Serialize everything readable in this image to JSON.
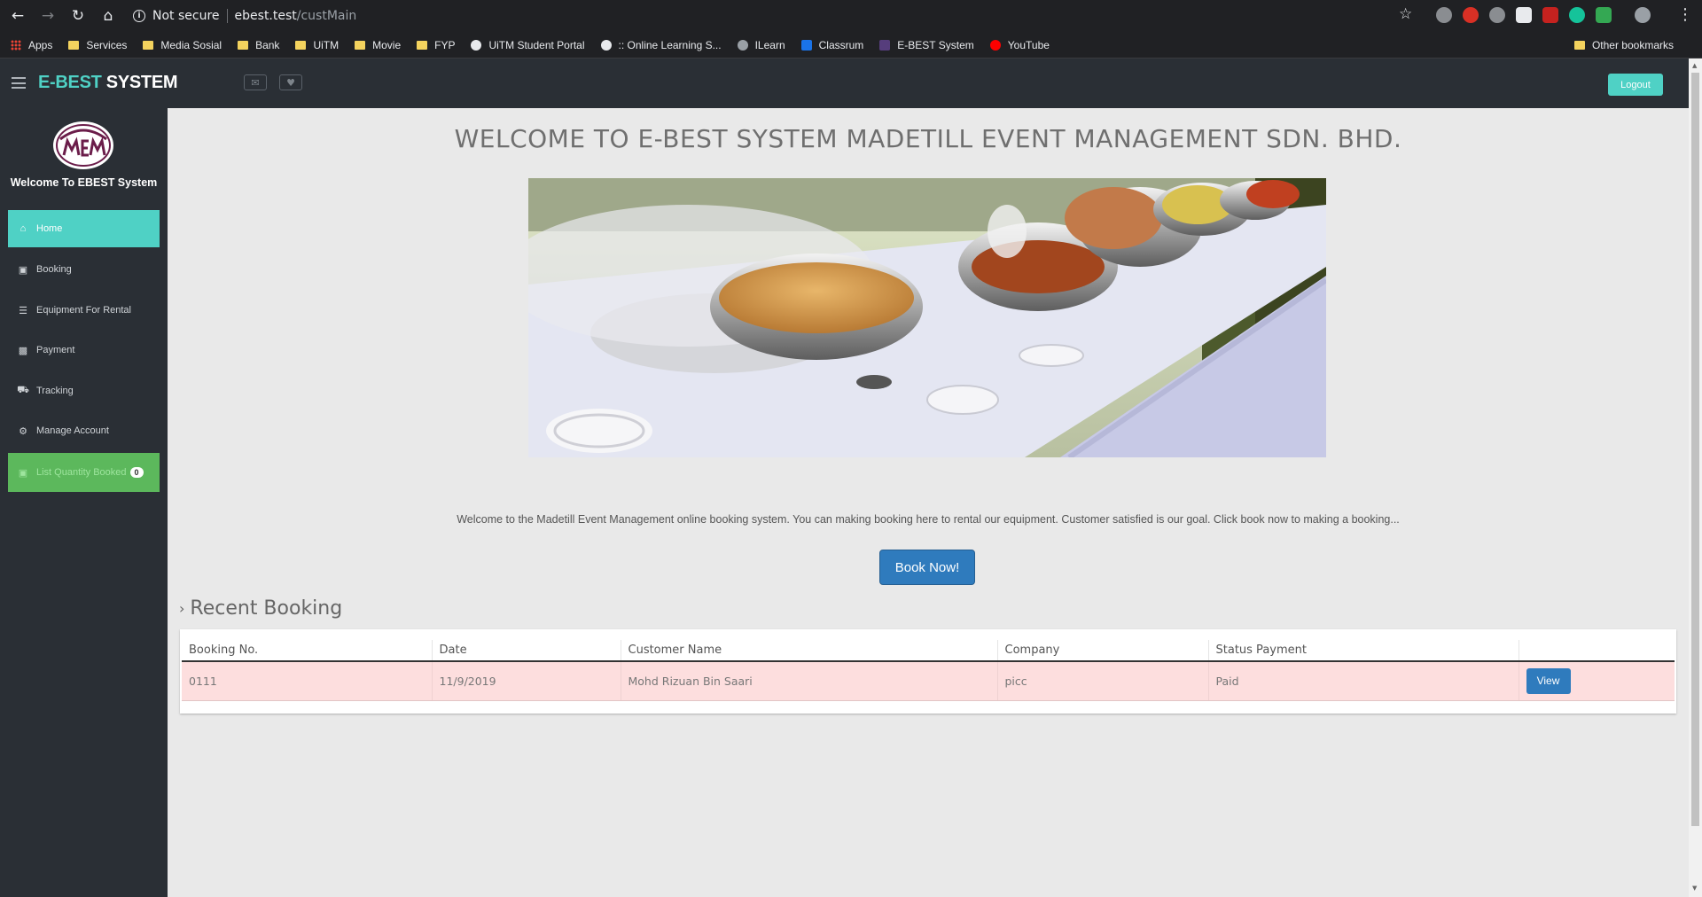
{
  "browser": {
    "security_label": "Not secure",
    "url_host": "ebest.test",
    "url_path": "/custMain",
    "bookmarks": [
      {
        "label": "Apps",
        "icon": "apps-grid-icon"
      },
      {
        "label": "Services",
        "icon": "folder-icon"
      },
      {
        "label": "Media Sosial",
        "icon": "folder-icon"
      },
      {
        "label": "Bank",
        "icon": "folder-icon"
      },
      {
        "label": "UiTM",
        "icon": "folder-icon"
      },
      {
        "label": "Movie",
        "icon": "folder-icon"
      },
      {
        "label": "FYP",
        "icon": "folder-icon"
      },
      {
        "label": "UiTM Student Portal",
        "icon": "globe-icon"
      },
      {
        "label": ":: Online Learning S...",
        "icon": "globe-icon"
      },
      {
        "label": "ILearn",
        "icon": "site-icon"
      },
      {
        "label": "Classrum",
        "icon": "classroom-icon"
      },
      {
        "label": "E-BEST System",
        "icon": "bootstrap-icon"
      },
      {
        "label": "YouTube",
        "icon": "youtube-icon"
      }
    ],
    "other_bookmarks": "Other bookmarks"
  },
  "header": {
    "brand_accent": "E-BEST",
    "brand_rest": " SYSTEM",
    "logout_label": "Logout"
  },
  "sidebar": {
    "welcome": "Welcome To EBEST System",
    "items": [
      {
        "label": "Home",
        "icon": "home-icon",
        "active": true
      },
      {
        "label": "Booking",
        "icon": "cart-icon"
      },
      {
        "label": "Equipment For Rental",
        "icon": "list-icon"
      },
      {
        "label": "Payment",
        "icon": "money-icon"
      },
      {
        "label": "Tracking",
        "icon": "truck-icon"
      },
      {
        "label": "Manage Account",
        "icon": "gears-icon"
      }
    ],
    "cart": {
      "label": "List Quantity Booked",
      "count": "0"
    }
  },
  "main": {
    "title": "WELCOME TO E-BEST SYSTEM MADETILL EVENT MANAGEMENT SDN. BHD.",
    "welcome_text": "Welcome to the Madetill Event Management online booking system. You can making booking here to rental our equipment. Customer satisfied is our goal. Click book now to making a booking...",
    "book_now": "Book Now!",
    "recent_heading": "Recent Booking",
    "table": {
      "headers": [
        "Booking No.",
        "Date",
        "Customer Name",
        "Company",
        "Status Payment",
        ""
      ],
      "rows": [
        {
          "booking_no": "0111",
          "date": "11/9/2019",
          "customer": "Mohd Rizuan Bin Saari",
          "company": "picc",
          "status": "Paid",
          "action": "View"
        }
      ]
    }
  },
  "colors": {
    "accent": "#4fd1c5",
    "sidebar_bg": "#2a2f35",
    "primary_button": "#2f7bbd",
    "cart_green": "#5cb85c",
    "row_highlight": "#fddede"
  }
}
